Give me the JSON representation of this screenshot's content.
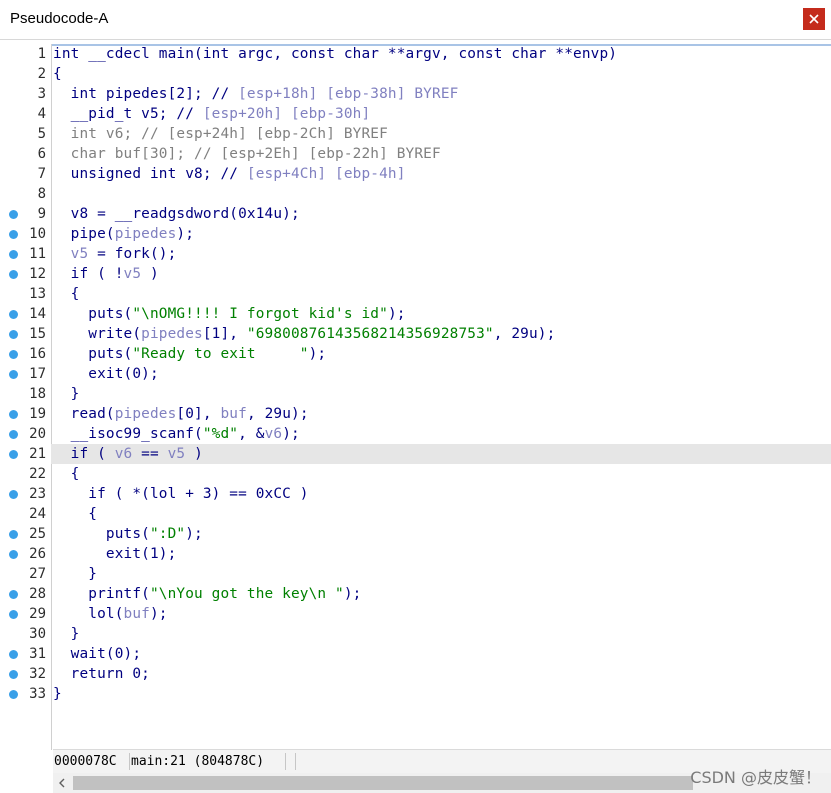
{
  "window": {
    "title": "Pseudocode-A"
  },
  "lines": [
    {
      "n": "1",
      "bp": false,
      "tokens": [
        [
          "p",
          "int __cdecl main(int argc, const char **argv, const char **envp)"
        ]
      ]
    },
    {
      "n": "2",
      "bp": false,
      "tokens": [
        [
          "p",
          "{"
        ]
      ]
    },
    {
      "n": "3",
      "bp": false,
      "tokens": [
        [
          "p",
          "  int pipedes[2]; // "
        ],
        [
          "c",
          "[esp+18h] [ebp-38h] BYREF"
        ]
      ]
    },
    {
      "n": "4",
      "bp": false,
      "tokens": [
        [
          "p",
          "  __pid_t v5; // "
        ],
        [
          "c",
          "[esp+20h] [ebp-30h]"
        ]
      ]
    },
    {
      "n": "5",
      "bp": false,
      "tokens": [
        [
          "g",
          "  int v6; // [esp+24h] [ebp-2Ch] BYREF"
        ]
      ]
    },
    {
      "n": "6",
      "bp": false,
      "tokens": [
        [
          "g",
          "  char buf[30]; // [esp+2Eh] [ebp-22h] BYREF"
        ]
      ]
    },
    {
      "n": "7",
      "bp": false,
      "tokens": [
        [
          "p",
          "  unsigned int v8; // "
        ],
        [
          "c",
          "[esp+4Ch] [ebp-4h]"
        ]
      ]
    },
    {
      "n": "8",
      "bp": false,
      "tokens": [
        [
          "p",
          ""
        ]
      ]
    },
    {
      "n": "9",
      "bp": true,
      "tokens": [
        [
          "p",
          "  v8 = __readgsdword(0x14u);"
        ]
      ]
    },
    {
      "n": "10",
      "bp": true,
      "tokens": [
        [
          "p",
          "  pipe("
        ],
        [
          "v",
          "pipedes"
        ],
        [
          "p",
          ");"
        ]
      ]
    },
    {
      "n": "11",
      "bp": true,
      "tokens": [
        [
          "p",
          "  "
        ],
        [
          "v",
          "v5"
        ],
        [
          "p",
          " = fork();"
        ]
      ]
    },
    {
      "n": "12",
      "bp": true,
      "tokens": [
        [
          "p",
          "  if ( !"
        ],
        [
          "v",
          "v5"
        ],
        [
          "p",
          " )"
        ]
      ]
    },
    {
      "n": "13",
      "bp": false,
      "tokens": [
        [
          "p",
          "  {"
        ]
      ]
    },
    {
      "n": "14",
      "bp": true,
      "tokens": [
        [
          "p",
          "    puts("
        ],
        [
          "s",
          "\"\\nOMG!!!! I forgot kid's id\""
        ],
        [
          "p",
          ");"
        ]
      ]
    },
    {
      "n": "15",
      "bp": true,
      "tokens": [
        [
          "p",
          "    write("
        ],
        [
          "v",
          "pipedes"
        ],
        [
          "p",
          "[1], "
        ],
        [
          "s",
          "\"69800876143568214356928753\""
        ],
        [
          "p",
          ", 29u);"
        ]
      ]
    },
    {
      "n": "16",
      "bp": true,
      "tokens": [
        [
          "p",
          "    puts("
        ],
        [
          "s",
          "\"Ready to exit     \""
        ],
        [
          "p",
          ");"
        ]
      ]
    },
    {
      "n": "17",
      "bp": true,
      "tokens": [
        [
          "p",
          "    exit(0);"
        ]
      ]
    },
    {
      "n": "18",
      "bp": false,
      "tokens": [
        [
          "p",
          "  }"
        ]
      ]
    },
    {
      "n": "19",
      "bp": true,
      "tokens": [
        [
          "p",
          "  read("
        ],
        [
          "v",
          "pipedes"
        ],
        [
          "p",
          "[0], "
        ],
        [
          "v",
          "buf"
        ],
        [
          "p",
          ", 29u);"
        ]
      ]
    },
    {
      "n": "20",
      "bp": true,
      "tokens": [
        [
          "p",
          "  __isoc99_scanf("
        ],
        [
          "s",
          "\"%d\""
        ],
        [
          "p",
          ", &"
        ],
        [
          "v",
          "v6"
        ],
        [
          "p",
          ");"
        ]
      ]
    },
    {
      "n": "21",
      "bp": true,
      "current": true,
      "tokens": [
        [
          "p",
          "  if ( "
        ],
        [
          "v",
          "v6"
        ],
        [
          "p",
          " == "
        ],
        [
          "v",
          "v5"
        ],
        [
          "p",
          " )"
        ]
      ]
    },
    {
      "n": "22",
      "bp": false,
      "tokens": [
        [
          "p",
          "  {"
        ]
      ]
    },
    {
      "n": "23",
      "bp": true,
      "tokens": [
        [
          "p",
          "    if ( *(lol + 3) == 0xCC )"
        ]
      ]
    },
    {
      "n": "24",
      "bp": false,
      "tokens": [
        [
          "p",
          "    {"
        ]
      ]
    },
    {
      "n": "25",
      "bp": true,
      "tokens": [
        [
          "p",
          "      puts("
        ],
        [
          "s",
          "\":D\""
        ],
        [
          "p",
          ");"
        ]
      ]
    },
    {
      "n": "26",
      "bp": true,
      "tokens": [
        [
          "p",
          "      exit(1);"
        ]
      ]
    },
    {
      "n": "27",
      "bp": false,
      "tokens": [
        [
          "p",
          "    }"
        ]
      ]
    },
    {
      "n": "28",
      "bp": true,
      "tokens": [
        [
          "p",
          "    printf("
        ],
        [
          "s",
          "\"\\nYou got the key\\n \""
        ],
        [
          "p",
          ");"
        ]
      ]
    },
    {
      "n": "29",
      "bp": true,
      "tokens": [
        [
          "p",
          "    lol("
        ],
        [
          "v",
          "buf"
        ],
        [
          "p",
          ");"
        ]
      ]
    },
    {
      "n": "30",
      "bp": false,
      "tokens": [
        [
          "p",
          "  }"
        ]
      ]
    },
    {
      "n": "31",
      "bp": true,
      "tokens": [
        [
          "p",
          "  wait(0);"
        ]
      ]
    },
    {
      "n": "32",
      "bp": true,
      "tokens": [
        [
          "p",
          "  return 0;"
        ]
      ]
    },
    {
      "n": "33",
      "bp": true,
      "tokens": [
        [
          "p",
          "}"
        ]
      ]
    }
  ],
  "status": {
    "address": "0000078C",
    "location": "main:21 (804878C)"
  },
  "watermark": "CSDN @皮皮蟹！",
  "colors": {
    "keyword": "#000080",
    "comment": "#8080c0",
    "string": "#008000",
    "variable": "#8080c0",
    "breakpoint": "#3aa0e8",
    "close": "#c42b1c"
  },
  "icons": {
    "close": "close-icon",
    "scroll_left": "chevron-left-icon"
  }
}
